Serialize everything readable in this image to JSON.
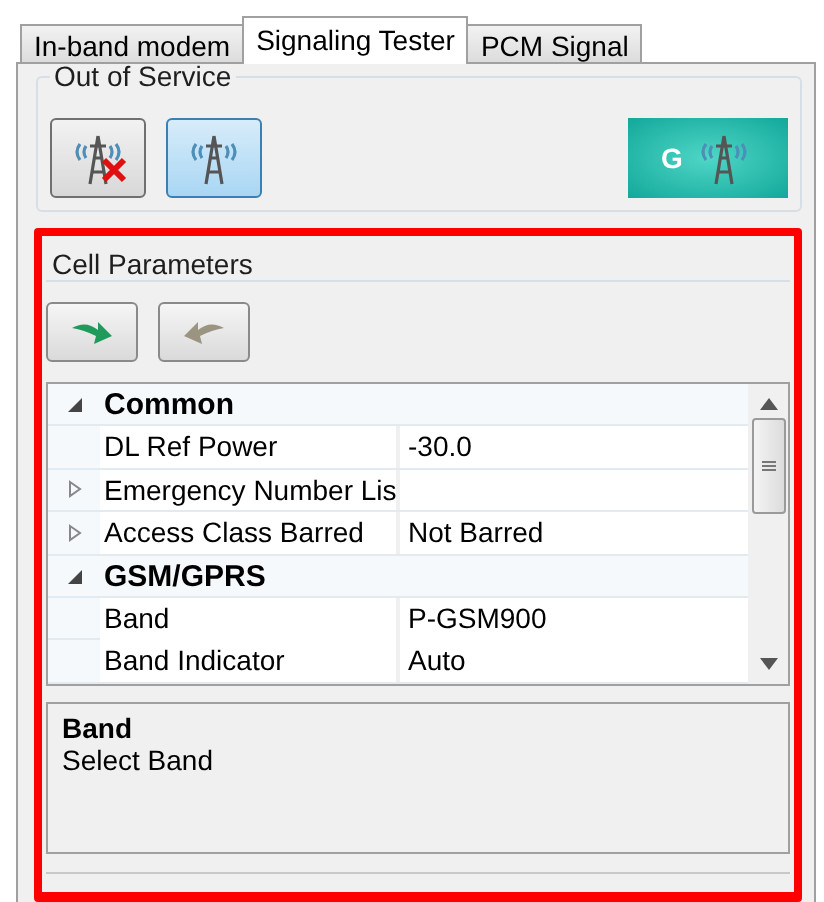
{
  "tabs": [
    {
      "label": "In-band modem",
      "selected": false
    },
    {
      "label": "Signaling Tester",
      "selected": true
    },
    {
      "label": "PCM Signal",
      "selected": false
    }
  ],
  "out_of_service": {
    "title": "Out of Service",
    "buttons": [
      {
        "kind": "cell-off",
        "pressed": false
      },
      {
        "kind": "cell-on",
        "pressed": true
      }
    ],
    "network_badge": {
      "label": "G"
    }
  },
  "cell_parameters": {
    "title": "Cell Parameters",
    "buttons": [
      {
        "kind": "apply",
        "disabled": false
      },
      {
        "kind": "revert",
        "disabled": true
      }
    ],
    "grid": [
      {
        "name": "Common",
        "expanded": true,
        "children": [
          {
            "name": "DL Ref Power",
            "value": "-30.0"
          },
          {
            "name": "Emergency Number Lis",
            "expanded": false
          },
          {
            "name": "Access Class Barred",
            "value": "Not Barred",
            "expanded": false
          }
        ]
      },
      {
        "name": "GSM/GPRS",
        "expanded": true,
        "children": [
          {
            "name": "Band",
            "value": "P-GSM900"
          },
          {
            "name": "Band Indicator",
            "value": "Auto"
          }
        ]
      }
    ],
    "description": {
      "title": "Band",
      "text": "Select Band"
    }
  }
}
